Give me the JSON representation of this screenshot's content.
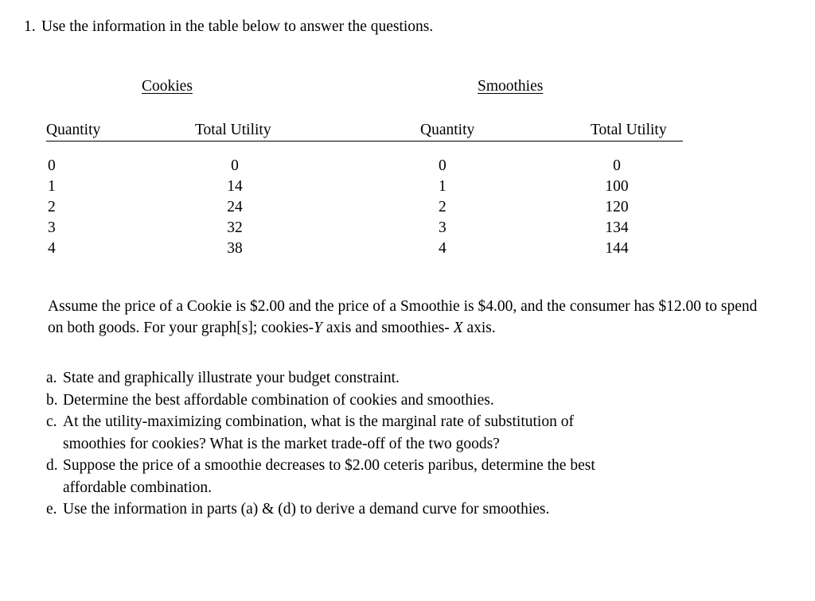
{
  "question": {
    "number": "1.",
    "text": "Use the information in the table below to answer the questions."
  },
  "table": {
    "groups": [
      {
        "label": "Cookies"
      },
      {
        "label": "Smoothies"
      }
    ],
    "column_headers": {
      "cookies_quantity": "Quantity",
      "cookies_total_utility": "Total Utility",
      "smoothies_quantity": "Quantity",
      "smoothies_total_utility": "Total Utility"
    },
    "rows": [
      {
        "cookies_q": "0",
        "cookies_tu": "0",
        "smoothies_q": "0",
        "smoothies_tu": "0"
      },
      {
        "cookies_q": "1",
        "cookies_tu": "14",
        "smoothies_q": "1",
        "smoothies_tu": "100"
      },
      {
        "cookies_q": "2",
        "cookies_tu": "24",
        "smoothies_q": "2",
        "smoothies_tu": "120"
      },
      {
        "cookies_q": "3",
        "cookies_tu": "32",
        "smoothies_q": "3",
        "smoothies_tu": "134"
      },
      {
        "cookies_q": "4",
        "cookies_tu": "38",
        "smoothies_q": "4",
        "smoothies_tu": "144"
      }
    ]
  },
  "assume_paragraph": {
    "part1": "Assume the price of a Cookie is $2.00 and the price of a Smoothie is $4.00, and the consumer has $12.00 to spend on both goods. For your graph[s]; cookies-",
    "axis_y": "Y",
    "part2": " axis and smoothies- ",
    "axis_x": "X",
    "part3": " axis."
  },
  "list": [
    {
      "marker": "a.",
      "text": "State and graphically illustrate your budget constraint.",
      "continuation": ""
    },
    {
      "marker": "b.",
      "text": "Determine the best affordable combination of cookies and smoothies.",
      "continuation": ""
    },
    {
      "marker": "c.",
      "text": "At the utility-maximizing combination, what is the marginal rate of substitution of",
      "continuation": "smoothies for cookies?  What is the market trade-off of the two goods?"
    },
    {
      "marker": "d.",
      "text": "Suppose the price of a smoothie decreases to $2.00 ceteris paribus, determine the best",
      "continuation": "affordable combination."
    },
    {
      "marker": "e.",
      "text": "Use the information in parts (a) & (d) to derive a demand curve for smoothies.",
      "continuation": ""
    }
  ]
}
